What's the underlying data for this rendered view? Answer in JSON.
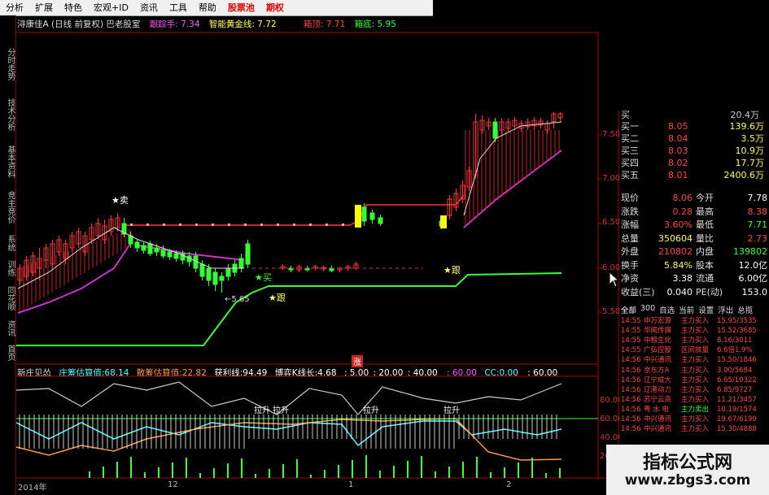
{
  "menu": {
    "items": [
      "分析",
      "扩展",
      "特色",
      "宏观+ID",
      "资讯",
      "工具",
      "帮助",
      "股票池",
      "期权"
    ],
    "highlight_index": 7
  },
  "left_tabs": [
    "分时走势",
    "技术分析",
    "基本资料",
    "竞主竞价",
    "系统",
    "训练",
    "同花顺",
    "资讯",
    "首页"
  ],
  "main_header": {
    "stock": "浔康佳A (日线 前复权) 巴老股室",
    "items": [
      {
        "label": "跟踪手:",
        "value": "7.34",
        "color": "#ff55ff"
      },
      {
        "label": "智能黄金线:",
        "value": "7.72",
        "color": "#ffff55"
      },
      {
        "label": "箱顶:",
        "value": "7.71",
        "color": "#ff4444"
      },
      {
        "label": "箱底:",
        "value": "5.95",
        "color": "#33ff33"
      }
    ]
  },
  "ind_header": {
    "name": "新庄见怂",
    "items": [
      {
        "label": "庄筹估算值:",
        "value": "68.14",
        "color": "#55ffff"
      },
      {
        "label": "散筹估算值:",
        "value": "22.82",
        "color": "#ff9944"
      },
      {
        "label": "获利线:",
        "value": "94.49",
        "color": "#ffffff"
      },
      {
        "label": "博弈K线长:",
        "value": "4.68",
        "color": "#ffffff"
      },
      {
        "label": "",
        "value": ": 5.00",
        "color": "#ffffff"
      },
      {
        "label": "",
        "value": ": 20.00",
        "color": "#ffffff"
      },
      {
        "label": "",
        "value": ": 40.00",
        "color": "#ffffff"
      },
      {
        "label": "",
        "value": ": 60.00",
        "color": "#ff55ff"
      },
      {
        "label": "CC:",
        "value": "0.00",
        "color": "#55ffff"
      },
      {
        "label": "",
        "value": ": 60.00",
        "color": "#ffffff"
      }
    ]
  },
  "price_axis": [
    "7.50",
    "7.00",
    "6.50",
    "6.00",
    "5.50"
  ],
  "ind_axis": [
    "80.00",
    "60.00",
    "40.00",
    "20.00"
  ],
  "signals": {
    "sell": "★卖",
    "buy1": "★买",
    "pull": "★跟",
    "low_mark": "←5.65",
    "bottom_tag": "涨"
  },
  "ind_labels": {
    "lift": "拉升",
    "lift2": "拉升 拉升"
  },
  "dates": [
    "2014年",
    "12",
    "1",
    "2"
  ],
  "quote": {
    "top_partial": [
      "买",
      "20.4万"
    ],
    "bids": [
      {
        "name": "买一",
        "price": "8.05",
        "vol": "139.6万"
      },
      {
        "name": "买二",
        "price": "8.04",
        "vol": "3.5万"
      },
      {
        "name": "买三",
        "price": "8.03",
        "vol": "10.9万"
      },
      {
        "name": "买四",
        "price": "8.02",
        "vol": "17.7万"
      },
      {
        "name": "买五",
        "price": "8.01",
        "vol": "2400.6万"
      }
    ],
    "stats": [
      [
        "现价",
        "8.06",
        "今开",
        "7.78"
      ],
      [
        "涨跌",
        "0.28",
        "最高",
        "8.38"
      ],
      [
        "涨幅",
        "3.60%",
        "最低",
        "7.71"
      ],
      [
        "总量",
        "350604",
        "量比",
        "2.73"
      ],
      [
        "外盘",
        "210802",
        "内盘",
        "139802"
      ],
      [
        "换手",
        "5.84%",
        "股本",
        "12.0亿"
      ],
      [
        "净资",
        "3.38",
        "流通",
        "6.00亿"
      ],
      [
        "收益(三)",
        "0.040",
        "PE(动)",
        "153.0"
      ]
    ],
    "tabs": [
      "全部",
      "300",
      "自选",
      "当前",
      "设置",
      "浮出",
      "总揽"
    ],
    "ticks": [
      [
        "14:55",
        "申万宏源",
        "主力买入",
        "15.95/3535"
      ],
      [
        "14:55",
        "华闻传媒",
        "主力买入",
        "15.52/3685"
      ],
      [
        "14:55",
        "中粮生化",
        "主力买入",
        "8.16/3011"
      ],
      [
        "14:55",
        "广弘控股",
        "区间放量",
        "6.6倍1.9%"
      ],
      [
        "14:56",
        "中兴通讯",
        "主力买入",
        "15.50/1846"
      ],
      [
        "14:56",
        "京东方A",
        "主力买入",
        "3.00/5684"
      ],
      [
        "14:56",
        "辽宁成大",
        "主力买入",
        "6.65/10322"
      ],
      [
        "14:56",
        "辽港动力",
        "主力买入",
        "6.85/9727"
      ],
      [
        "14:56",
        "苏宁云商",
        "主力买入",
        "11.21/3457"
      ],
      [
        "14:56",
        "粤 水 电",
        "主力卖出",
        "10.19/1574"
      ],
      [
        "14:56",
        "中兴通讯",
        "主力买入",
        "19.67/6199"
      ],
      [
        "14:56",
        "中兴通讯",
        "主力买入",
        "15.30/4888"
      ]
    ]
  },
  "watermark": {
    "title": "指标公式网",
    "url": "www.zbgs3.com"
  },
  "colors": {
    "up": "#ff3333",
    "down": "#33ff33",
    "axis": "#aa0000",
    "magenta": "#cc33cc",
    "yellow": "#ffff00",
    "cyan": "#55ffff"
  }
}
